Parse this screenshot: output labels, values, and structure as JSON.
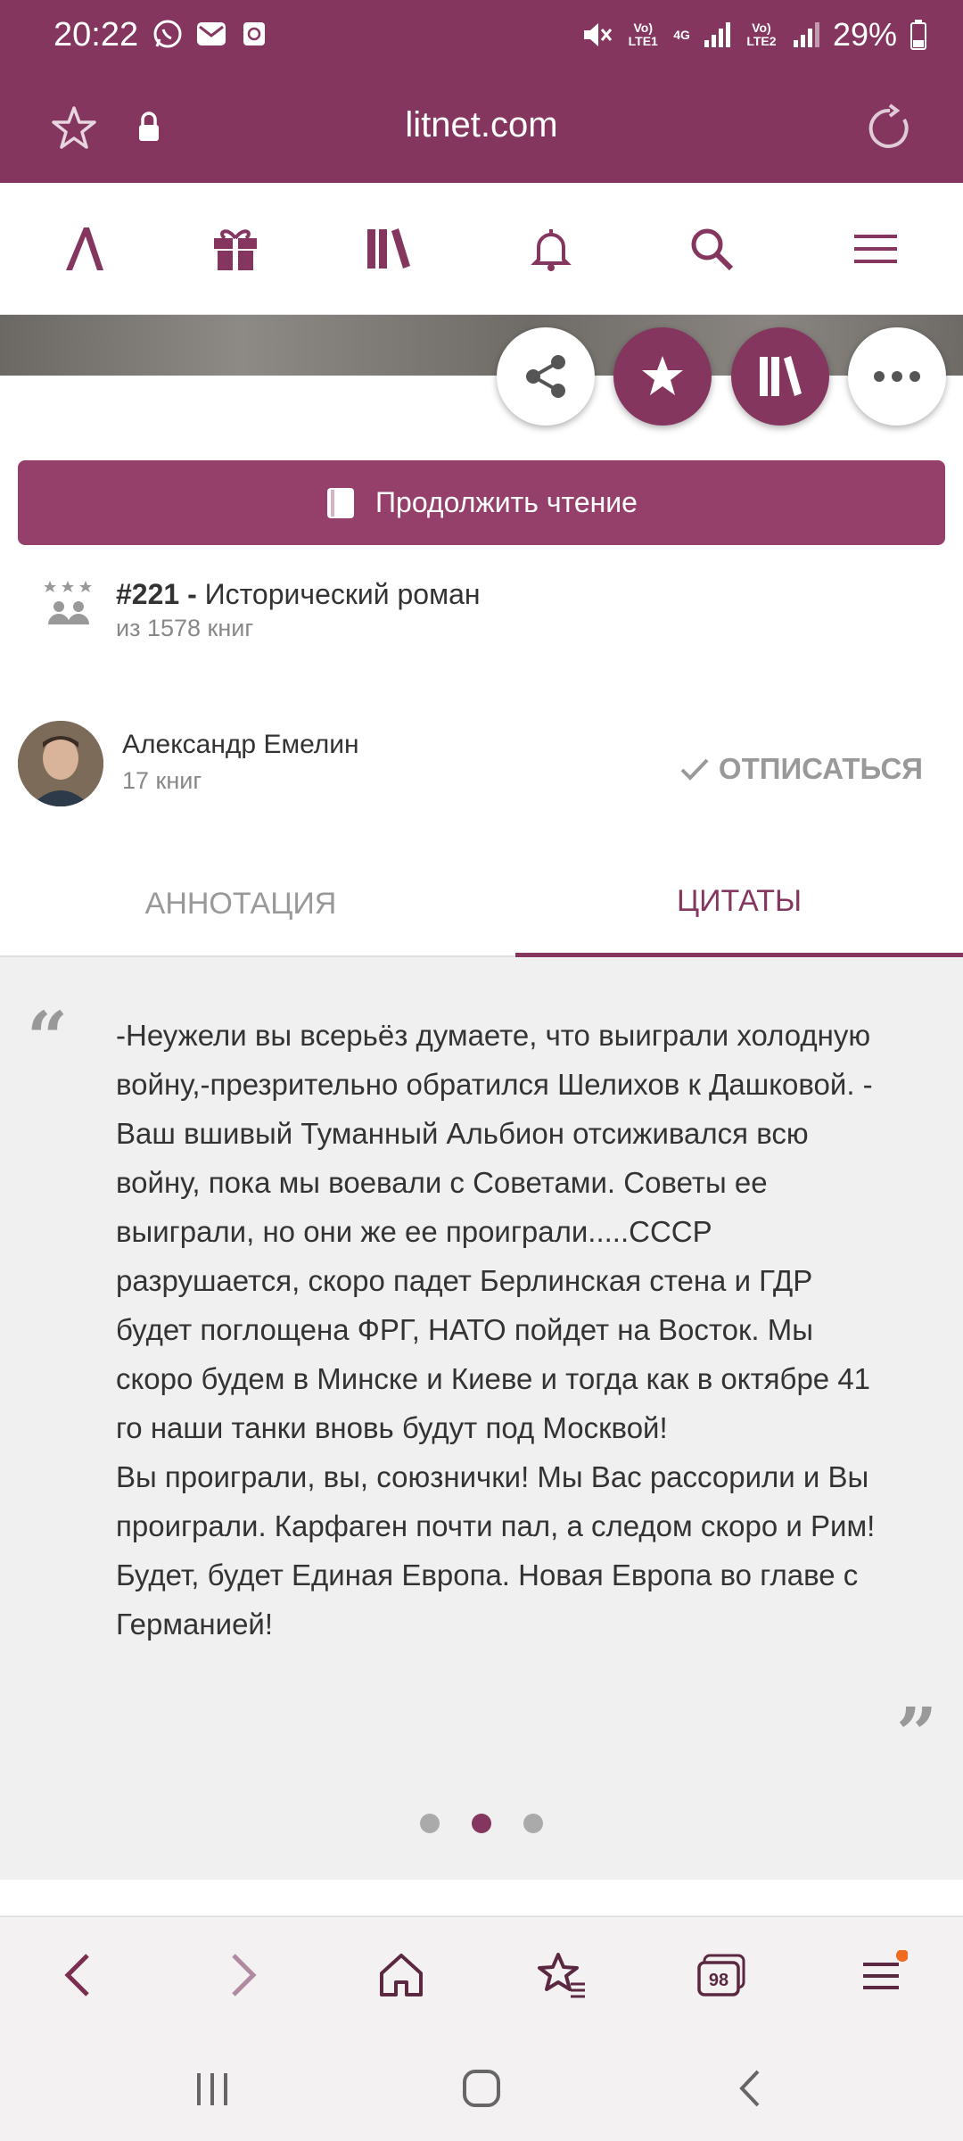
{
  "status_bar": {
    "time": "20:22",
    "battery": "29%",
    "sim1_label": "Vo) LTE1",
    "sim2_label": "Vo) LTE2",
    "network": "4G"
  },
  "browser": {
    "url": "litnet.com",
    "tab_count": "98"
  },
  "actions": {
    "continue_label": "Продолжить чтение"
  },
  "rank": {
    "number": "#221 -",
    "genre": "Исторический роман",
    "sub": "из 1578 книг"
  },
  "author": {
    "name": "Александр Емелин",
    "books": "17 книг",
    "unsubscribe_label": "ОТПИСАТЬСЯ"
  },
  "tabs": {
    "annotation": "АННОТАЦИЯ",
    "quotes": "ЦИТАТЫ"
  },
  "quote": {
    "paragraph1": "-Неужели вы всерьёз думаете, что выиграли холодную войну,-презрительно обратился Шелихов к Дашковой. - Ваш вшивый Туманный Альбион отсиживался всю войну, пока мы воевали с Советами. Советы ее выиграли, но они же ее проиграли.....СССР разрушается, скоро падет Берлинская стена и ГДР будет поглощена ФРГ, НАТО пойдет на Восток. Мы скоро будем в Минске и Киеве и тогда как в октябре 41 го наши танки вновь будут под Москвой!",
    "paragraph2": "Вы проиграли, вы, союзнички! Мы Вас рассорили и Вы проиграли. Карфаген почти пал, а следом скоро и Рим! Будет, будет Единая Европа. Новая Европа во главе с Германией!",
    "open_mark": "“",
    "close_mark": "”",
    "pagination": {
      "total": 3,
      "active": 2
    }
  },
  "colors": {
    "brand": "#85365f",
    "button": "#95406a"
  }
}
